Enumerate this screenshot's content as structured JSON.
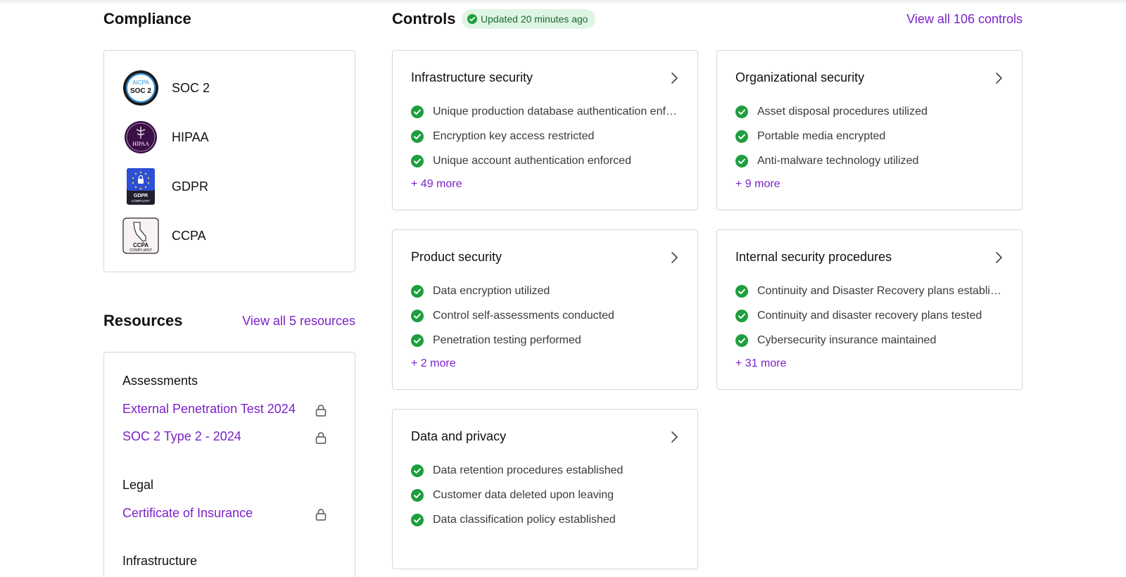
{
  "compliance": {
    "title": "Compliance",
    "frameworks": [
      {
        "label": "SOC 2",
        "badge_text": [
          "AICPA",
          "SOC 2"
        ],
        "icon": "soc2-badge-icon"
      },
      {
        "label": "HIPAA",
        "badge_text": [
          "HIPAA"
        ],
        "icon": "hipaa-badge-icon"
      },
      {
        "label": "GDPR",
        "badge_text": [
          "GDPR",
          "COMPLIANT"
        ],
        "icon": "gdpr-badge-icon"
      },
      {
        "label": "CCPA",
        "badge_text": [
          "CCPA",
          "COMPLIANT"
        ],
        "icon": "ccpa-badge-icon"
      }
    ]
  },
  "resources": {
    "title": "Resources",
    "view_all": "View all 5 resources",
    "groups": [
      {
        "name": "Assessments",
        "items": [
          "External Penetration Test 2024",
          "SOC 2 Type 2 - 2024"
        ]
      },
      {
        "name": "Legal",
        "items": [
          "Certificate of Insurance"
        ]
      },
      {
        "name": "Infrastructure",
        "items": []
      }
    ]
  },
  "controls": {
    "title": "Controls",
    "updated": "Updated 20 minutes ago",
    "view_all": "View all 106 controls",
    "cards": [
      {
        "title": "Infrastructure security",
        "items": [
          "Unique production database authentication enforced",
          "Encryption key access restricted",
          "Unique account authentication enforced"
        ],
        "more": "+ 49 more"
      },
      {
        "title": "Organizational security",
        "items": [
          "Asset disposal procedures utilized",
          "Portable media encrypted",
          "Anti-malware technology utilized"
        ],
        "more": "+ 9 more"
      },
      {
        "title": "Product security",
        "items": [
          "Data encryption utilized",
          "Control self-assessments conducted",
          "Penetration testing performed"
        ],
        "more": "+ 2 more"
      },
      {
        "title": "Internal security procedures",
        "items": [
          "Continuity and Disaster Recovery plans established",
          "Continuity and disaster recovery plans tested",
          "Cybersecurity insurance maintained"
        ],
        "more": "+ 31 more"
      },
      {
        "title": "Data and privacy",
        "items": [
          "Data retention procedures established",
          "Customer data deleted upon leaving",
          "Data classification policy established"
        ],
        "more": ""
      }
    ]
  },
  "colors": {
    "accent": "#7b22c9",
    "success": "#1e9e3e",
    "border": "#d6d6d6"
  }
}
